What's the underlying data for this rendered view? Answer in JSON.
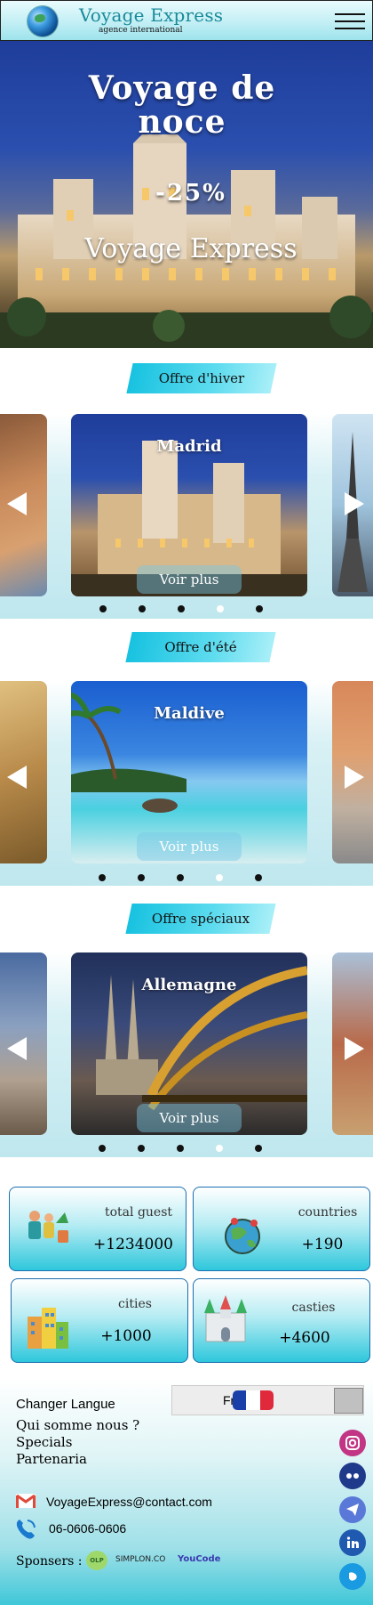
{
  "header": {
    "brand": "Voyage Express",
    "tagline": "agence international",
    "logo_icon": "globe-logo-icon",
    "menu_icon": "hamburger-menu-icon"
  },
  "hero": {
    "title": "Voyage de noce",
    "promo": "-25%",
    "brand": "Voyage Express"
  },
  "offers": [
    {
      "section_label": "Offre d'hiver",
      "destination": "Madrid",
      "button": "Voir plus"
    },
    {
      "section_label": "Offre d'été",
      "destination": "Maldive",
      "button": "Voir plus"
    },
    {
      "section_label": "Offre spéciaux",
      "destination": "Allemagne",
      "button": "Voir plus"
    }
  ],
  "carousel": {
    "dot_count": 5,
    "active_dot": 4
  },
  "stats": [
    {
      "label": "total guest",
      "value": "+1234000",
      "icon": "guests-icon"
    },
    {
      "label": "countries",
      "value": "+190",
      "icon": "globe-pins-icon"
    },
    {
      "label": "cities",
      "value": "+1000",
      "icon": "city-buildings-icon"
    },
    {
      "label": "casties",
      "value": "+4600",
      "icon": "castle-icon"
    }
  ],
  "footer": {
    "change_language": "Changer Langue",
    "language_selected": "Fr",
    "links": [
      "Qui somme nous ?",
      "Specials",
      "Partenaria"
    ],
    "email": "VoyageExpress@contact.com",
    "phone": "06-0606-0606",
    "sponsors_label": "Sponsers :",
    "sponsors": [
      "OLP",
      "SIMPLON.CO",
      "YouCode"
    ],
    "social_icons": [
      "instagram-icon",
      "tripadvisor-icon",
      "telegram-icon",
      "linkedin-icon",
      "skype-icon"
    ]
  },
  "colors": {
    "accent": "#17c2e0",
    "brand_text": "#1a8a9a",
    "instagram": "#c13584",
    "dark_blue": "#1f3a8a"
  }
}
